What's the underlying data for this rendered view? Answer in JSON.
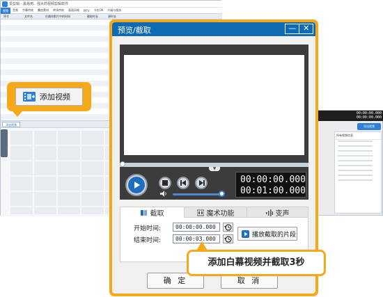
{
  "background_app": {
    "title": "爱剪辑 - 最易用、强大的视频剪辑软件",
    "menu": [
      "视频",
      "音频",
      "字幕特效",
      "叠加素材",
      "转场特效",
      "画面风格",
      "MTV",
      "卡拉OK",
      "升级与服务"
    ],
    "columns": [
      "序号",
      "文件名",
      "在最终影片中的时间",
      "截取时长",
      "源时长"
    ],
    "lower_tab": "添加视频",
    "time_current": "00:00:00.000",
    "time_total": "00:00:00.000",
    "export_label": "导出视频",
    "info_panel_title": "所有视频信息",
    "side_tab": "已添加片段"
  },
  "dialog": {
    "title": "预览/截取",
    "minimize": "—",
    "close": "✕",
    "time_current": "00:00:00.000",
    "time_total": "00:01:00.000",
    "tabs": [
      {
        "label": "截取",
        "icon": "scissors-icon"
      },
      {
        "label": "魔术功能",
        "icon": "magic-icon"
      },
      {
        "label": "变声",
        "icon": "voice-icon"
      }
    ],
    "start_label": "开始时间:",
    "start_value": "00:00:00.000",
    "end_label": "结束时间:",
    "end_value": "00:00:03.000",
    "play_clip_label": "播放截取的片段",
    "ok_label": "确 定",
    "cancel_label": "取 消",
    "playback": {
      "position_fraction": 0.0,
      "volume_fraction": 0.95
    }
  },
  "callouts": {
    "add_video_label": "添加视频",
    "instruction": "添加白幕视频并截取3秒"
  },
  "colors": {
    "accent_orange": "#f6a81b",
    "title_blue": "#0f6ab4",
    "play_blue": "#1f6fc0"
  }
}
